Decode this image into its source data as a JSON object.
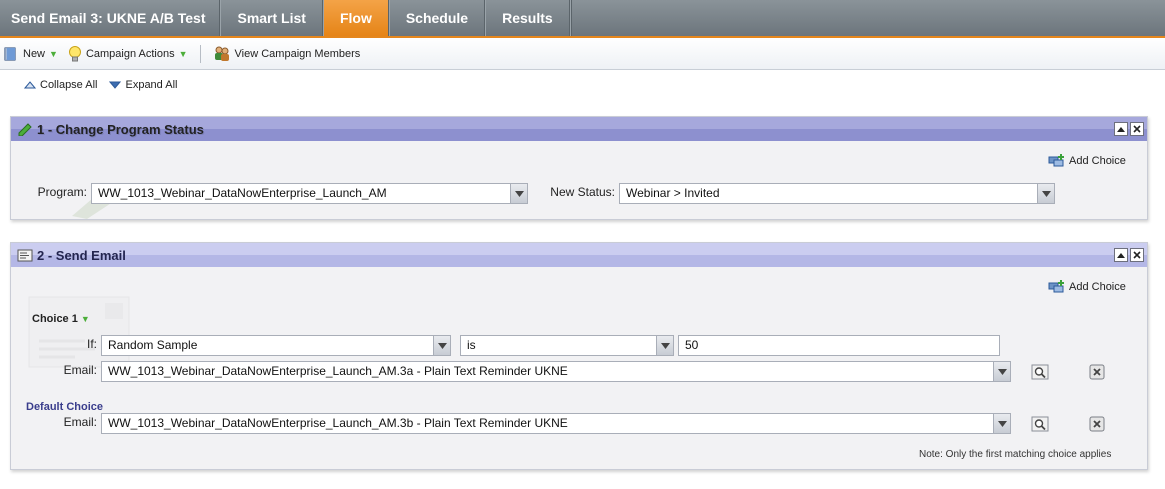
{
  "tabs": [
    {
      "label": "Send Email 3: UKNE A/B Test",
      "active": false
    },
    {
      "label": "Smart List",
      "active": false
    },
    {
      "label": "Flow",
      "active": true
    },
    {
      "label": "Schedule",
      "active": false
    },
    {
      "label": "Results",
      "active": false
    }
  ],
  "toolbar": {
    "new_label": "New",
    "campaign_actions_label": "Campaign Actions",
    "view_members_label": "View Campaign Members"
  },
  "collapse_label": "Collapse All",
  "expand_label": "Expand All",
  "step1": {
    "title": "1 - Change Program Status",
    "add_choice": "Add Choice",
    "program_label": "Program:",
    "program_value": "WW_1013_Webinar_DataNowEnterprise_Launch_AM",
    "status_label": "New Status:",
    "status_value": "Webinar > Invited"
  },
  "step2": {
    "title": "2 - Send Email",
    "add_choice": "Add Choice",
    "choice1_label": "Choice 1",
    "if_label": "If:",
    "if_field": "Random Sample",
    "operator": "is",
    "if_value": "50",
    "email_label": "Email:",
    "email1_value": "WW_1013_Webinar_DataNowEnterprise_Launch_AM.3a - Plain Text Reminder UKNE",
    "default_label": "Default Choice",
    "default_email_label": "Email:",
    "email2_value": "WW_1013_Webinar_DataNowEnterprise_Launch_AM.3b - Plain Text Reminder UKNE",
    "note": "Note: Only the first matching choice applies"
  },
  "colors": {
    "accent_orange": "#e58417",
    "tab_bar_gray": "#7a8389",
    "panel_header_lavender": "#b4b7e6",
    "default_choice_blue": "#3a3d8c"
  }
}
